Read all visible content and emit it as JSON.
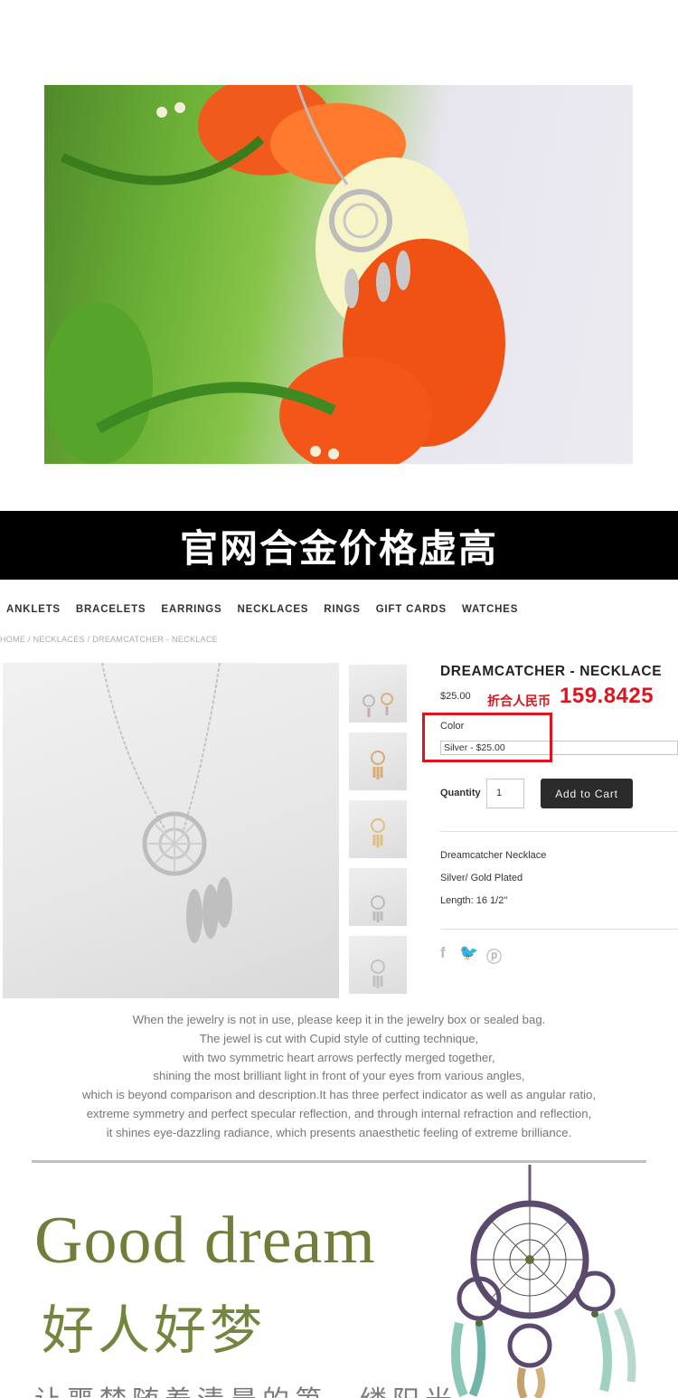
{
  "banner": {
    "text": "官网合金价格虚高"
  },
  "nav": {
    "items": [
      "ANKLETS",
      "BRACELETS",
      "EARRINGS",
      "NECKLACES",
      "RINGS",
      "GIFT CARDS",
      "WATCHES"
    ]
  },
  "breadcrumb": "HOME / NECKLACES / DREAMCATCHER - NECKLACE",
  "product": {
    "title": "DREAMCATCHER - NECKLACE",
    "price": "$25.00",
    "cny_label": "折合人民币",
    "cny_value": "159.8425",
    "color_label": "Color",
    "color_selected": "Silver - $25.00",
    "quantity_label": "Quantity",
    "quantity_value": "1",
    "add_to_cart": "Add to Cart",
    "description": [
      "Dreamcatcher Necklace",
      "Silver/ Gold Plated",
      "Length: 16 1/2\""
    ],
    "thumbnails": [
      "silver-gold-pair",
      "gold",
      "gold-light",
      "silver",
      "silver-light"
    ]
  },
  "social": {
    "icons": [
      "facebook-icon",
      "twitter-icon",
      "pinterest-icon"
    ],
    "glyphs": [
      "f",
      "🐦",
      "ⓟ"
    ]
  },
  "paragraph": [
    "When the jewelry is not in use, please keep it in the jewelry box or sealed bag.",
    "The jewel is cut with Cupid style of cutting technique,",
    "with two symmetric heart arrows perfectly merged together,",
    "shining the most brilliant light in front of your eyes from various angles,",
    "which is beyond comparison and description.It has three perfect indicator as well as angular ratio,",
    "extreme symmetry and perfect specular reflection, and through internal refraction and reflection,",
    "it shines eye-dazzling radiance, which presents anaesthetic feeling of extreme brilliance."
  ],
  "good_dream": {
    "en": "Good dream",
    "cn": "好人好梦",
    "tail": "让噩梦随着清晨的第一缕阳光"
  },
  "colors": {
    "accent_red": "#e0141e",
    "button_dark": "#2b2b2b",
    "olive": "#6f7f3a"
  }
}
